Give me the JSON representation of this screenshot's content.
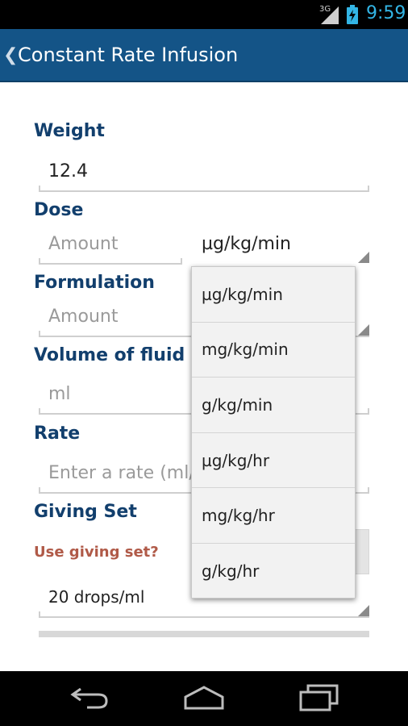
{
  "status_bar": {
    "network": "3G",
    "time": "9:59"
  },
  "action_bar": {
    "title": "Constant Rate Infusion",
    "back_glyph": "❮"
  },
  "form": {
    "weight": {
      "label": "Weight",
      "value": "12.4"
    },
    "dose": {
      "label": "Dose",
      "placeholder": "Amount",
      "unit": "µg/kg/min"
    },
    "formulation": {
      "label": "Formulation",
      "placeholder": "Amount"
    },
    "volume": {
      "label": "Volume of fluid",
      "placeholder": "ml"
    },
    "rate": {
      "label": "Rate",
      "placeholder": "Enter a rate (ml/"
    },
    "giving_set": {
      "label": "Giving Set",
      "toggle_label": "Use giving set?",
      "value": "20 drops/ml"
    }
  },
  "dropdown": {
    "options": [
      "µg/kg/min",
      "mg/kg/min",
      "g/kg/min",
      "µg/kg/hr",
      "mg/kg/hr",
      "g/kg/hr"
    ]
  },
  "colors": {
    "action_bar": "#145487",
    "label": "#123f6d",
    "sublabel": "#b05a48",
    "status_time": "#33b5e5"
  },
  "icons": {
    "back": "chevron-left-icon",
    "signal": "signal-icon",
    "battery": "battery-charging-icon",
    "nav_back": "nav-back-icon",
    "nav_home": "nav-home-icon",
    "nav_recents": "nav-recents-icon"
  }
}
